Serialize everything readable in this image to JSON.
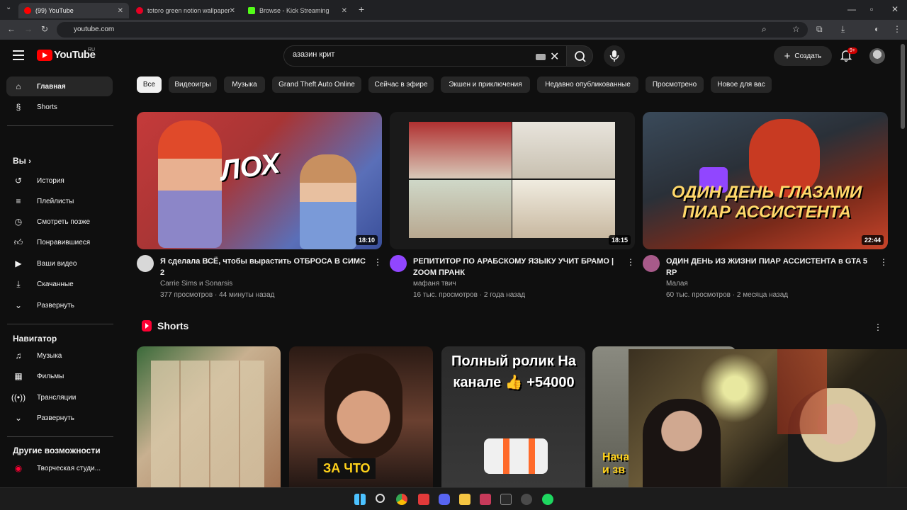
{
  "browser": {
    "tabs": [
      {
        "label": "(99) YouTube",
        "color": "#ff0000"
      },
      {
        "label": "totoro green notion wallpaper",
        "color": "#e60023"
      },
      {
        "label": "Browse - Kick Streaming",
        "color": "#53fc18"
      }
    ],
    "url": "youtube.com"
  },
  "header": {
    "logo_text": "YouTube",
    "region": "RU",
    "search_value": "азазин крит",
    "create_label": "Создать",
    "notifications_badge": "9+"
  },
  "sidebar": {
    "primary": [
      {
        "label": "Главная",
        "icon": "home-icon"
      },
      {
        "label": "Shorts",
        "icon": "shorts-icon"
      }
    ],
    "you_heading": "Вы",
    "you_items": [
      {
        "label": "История",
        "icon": "history-icon"
      },
      {
        "label": "Плейлисты",
        "icon": "playlists-icon"
      },
      {
        "label": "Смотреть позже",
        "icon": "watch-later-icon"
      },
      {
        "label": "Понравившиеся",
        "icon": "like-icon"
      },
      {
        "label": "Ваши видео",
        "icon": "your-videos-icon"
      },
      {
        "label": "Скачанные",
        "icon": "download-icon"
      },
      {
        "label": "Развернуть",
        "icon": "chevron-down-icon"
      }
    ],
    "navigator_heading": "Навигатор",
    "navigator_items": [
      {
        "label": "Музыка",
        "icon": "music-icon"
      },
      {
        "label": "Фильмы",
        "icon": "film-icon"
      },
      {
        "label": "Трансляции",
        "icon": "live-icon"
      },
      {
        "label": "Развернуть",
        "icon": "chevron-down-icon"
      }
    ],
    "more_heading": "Другие возможности",
    "more_items": [
      {
        "label": "Творческая студи...",
        "icon": "studio-icon"
      }
    ]
  },
  "chips": [
    "Все",
    "Видеоигры",
    "Музыка",
    "Grand Theft Auto Online",
    "Сейчас в эфире",
    "Экшен и приключения",
    "Недавно опубликованные",
    "Просмотрено",
    "Новое для вас"
  ],
  "videos": [
    {
      "title": "Я сделала ВСЁ, чтобы вырастить ОТБРОСА В СИМС 2",
      "channel": "Carrie Sims и Sonarsis",
      "meta": "377 просмотров · 44 минуты назад",
      "duration": "18:10",
      "thumb_text": "ЛОХ"
    },
    {
      "title": "РЕПИТИТОР ПО АРАБСКОМУ ЯЗЫКУ УЧИТ БРАМО | ZOOM ПРАНК",
      "channel": "мафаня твич",
      "meta": "16 тыс. просмотров · 2 года назад",
      "duration": "18:15",
      "thumb_text": ""
    },
    {
      "title": "ОДИН ДЕНЬ ИЗ ЖИЗНИ ПИАР АССИСТЕНТА в GTA 5 RP",
      "channel": "Малая",
      "meta": "60 тыс. просмотров · 2 месяца назад",
      "duration": "22:44",
      "thumb_text": "ОДИН ДЕНЬ ГЛАЗАМИ ПИАР АССИСТЕНТА"
    }
  ],
  "shorts": {
    "heading": "Shorts",
    "items": [
      {
        "thumb_text": ""
      },
      {
        "thumb_text": "ЗА ЧТО"
      },
      {
        "thumb_text": "Полный ролик На канале 👍 +54000"
      },
      {
        "thumb_text": "Нача и зв"
      }
    ]
  }
}
